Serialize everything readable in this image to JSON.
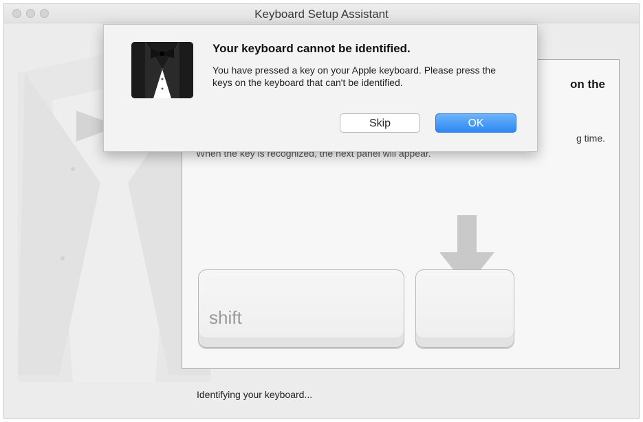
{
  "window": {
    "title": "Keyboard Setup Assistant"
  },
  "panel": {
    "heading_fragment": "on the",
    "text_fragment": "g time.",
    "partial_text": "When the key is recognized, the next panel will appear.",
    "key_shift_label": "shift"
  },
  "status": {
    "text": "Identifying your keyboard..."
  },
  "alert": {
    "title": "Your keyboard cannot be identified.",
    "message": "You have pressed a key on your Apple keyboard. Please press the keys on the keyboard that can't be identified.",
    "skip_label": "Skip",
    "ok_label": "OK",
    "icon": "tuxedo-icon"
  },
  "colors": {
    "accent": "#2e87f2",
    "window_bg": "#ececec"
  }
}
